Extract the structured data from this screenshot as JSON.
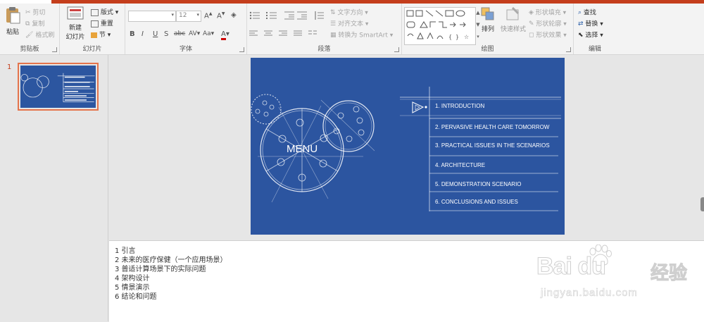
{
  "ribbon": {
    "clipboard": {
      "paste_label": "粘贴",
      "cut_label": "剪切",
      "copy_label": "复制",
      "format_painter_label": "格式刷",
      "group_label": "剪贴板"
    },
    "slides": {
      "new_slide_label_1": "新建",
      "new_slide_label_2": "幻灯片",
      "layout_label": "版式",
      "reset_label": "重置",
      "section_label": "节",
      "group_label": "幻灯片"
    },
    "font": {
      "font_name_value": "",
      "font_size_value": "12",
      "group_label": "字体",
      "bold": "B",
      "italic": "I",
      "underline": "U",
      "shadow": "S",
      "strike": "abc",
      "spacing": "AV",
      "case": "Aa",
      "grow": "A",
      "shrink": "A"
    },
    "paragraph": {
      "text_direction_label": "文字方向",
      "align_text_label": "对齐文本",
      "smartart_label": "转换为 SmartArt",
      "group_label": "段落"
    },
    "drawing": {
      "arrange_label": "排列",
      "quick_styles_label": "快速样式",
      "shape_fill_label": "形状填充",
      "shape_outline_label": "形状轮廓",
      "shape_effects_label": "形状效果",
      "group_label": "绘图"
    },
    "editing": {
      "find_label": "查找",
      "replace_label": "替换",
      "select_label": "选择",
      "group_label": "编辑"
    }
  },
  "thumbnails": {
    "slide_number": "1"
  },
  "slide": {
    "title": "MENU",
    "items": [
      "1. INTRODUCTION",
      "2. PERVASIVE HEALTH CARE TOMORROW",
      "3. PRACTICAL ISSUES IN THE SCENARIOS",
      "4. ARCHITECTURE",
      "5. DEMONSTRATION SCENARIO",
      "6. CONCLUSIONS AND ISSUES"
    ]
  },
  "notes": {
    "lines": [
      "1 引言",
      "2 未来的医疗保健（一个应用场景）",
      "3 普适计算场景下的实际问题",
      "4 架构设计",
      "5 情景演示",
      "6 结论和问题"
    ]
  },
  "watermark": {
    "brand": "Bai du",
    "cn": "经验",
    "url": "jingyan.baidu.com"
  },
  "colors": {
    "accent": "#c43e1c",
    "slide_bg": "#2c55a0",
    "thumb_border": "#e4744c"
  }
}
